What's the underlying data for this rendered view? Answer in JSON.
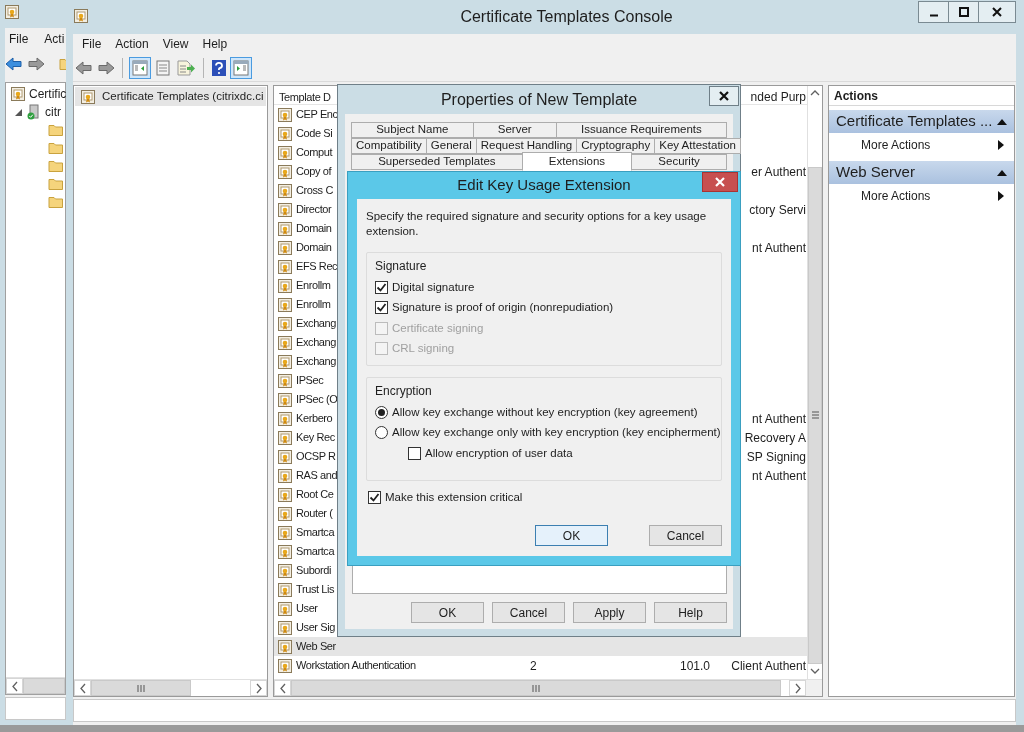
{
  "background_window": {
    "menu": [
      "File",
      "Acti"
    ],
    "tree": [
      {
        "label": "Certific",
        "children": [
          {
            "label": "citr",
            "expanded": true
          }
        ]
      }
    ]
  },
  "main_window": {
    "title": "Certificate Templates Console",
    "menu": [
      "File",
      "Action",
      "View",
      "Help"
    ],
    "tree": [
      {
        "label": "Certificate Templates (citrixdc.ci",
        "selected": true
      }
    ],
    "template_list": {
      "columns": [
        "Template D",
        "nded Purp"
      ],
      "rows": [
        {
          "name": "CEP Enc",
          "selected": false
        },
        {
          "name": "Code Si",
          "selected": false
        },
        {
          "name": "Comput",
          "selected": false
        },
        {
          "name": "Copy of",
          "purpose": "er Authent",
          "selected": false
        },
        {
          "name": "Cross C",
          "selected": false
        },
        {
          "name": "Director",
          "purpose": "ctory Servi",
          "selected": false
        },
        {
          "name": "Domain",
          "selected": false
        },
        {
          "name": "Domain",
          "purpose": "nt Authent",
          "selected": false
        },
        {
          "name": "EFS Rec",
          "selected": false
        },
        {
          "name": "Enrollm",
          "selected": false
        },
        {
          "name": "Enrollm",
          "selected": false
        },
        {
          "name": "Exchang",
          "selected": false
        },
        {
          "name": "Exchang",
          "selected": false
        },
        {
          "name": "Exchang",
          "selected": false
        },
        {
          "name": "IPSec",
          "selected": false
        },
        {
          "name": "IPSec (O",
          "selected": false
        },
        {
          "name": "Kerbero",
          "purpose": "nt Authent",
          "selected": false
        },
        {
          "name": "Key Rec",
          "purpose": "Recovery A",
          "selected": false
        },
        {
          "name": "OCSP R",
          "purpose": "SP Signing",
          "selected": false
        },
        {
          "name": "RAS and",
          "purpose": "nt Authent",
          "selected": false
        },
        {
          "name": "Root Ce",
          "selected": false
        },
        {
          "name": "Router (",
          "selected": false
        },
        {
          "name": "Smartca",
          "selected": false
        },
        {
          "name": "Smartca",
          "selected": false
        },
        {
          "name": "Subordi",
          "selected": false
        },
        {
          "name": "Trust Lis",
          "selected": false
        },
        {
          "name": "User",
          "selected": false
        },
        {
          "name": "User Sig",
          "selected": false
        },
        {
          "name": "Web Ser",
          "selected": true
        },
        {
          "name": "Workstation Authentication",
          "column_2": "2",
          "column_3": "101.0",
          "purpose": "Client Authent",
          "selected": false
        }
      ]
    },
    "actions": {
      "title": "Actions",
      "groups": [
        {
          "title": "Certificate Templates ...",
          "expanded": true,
          "items": [
            "More Actions"
          ]
        },
        {
          "title": "Web Server",
          "expanded": true,
          "items": [
            "More Actions"
          ]
        }
      ]
    }
  },
  "properties_dialog": {
    "title": "Properties of New Template",
    "tab_rows": [
      {
        "tabs": [
          {
            "label": "Subject Name",
            "selected": false
          },
          {
            "label": "Server",
            "selected": false
          },
          {
            "label": "Issuance Requirements",
            "selected": false
          }
        ]
      },
      {
        "tabs": [
          {
            "label": "Compatibility",
            "selected": false
          },
          {
            "label": "General",
            "selected": false
          },
          {
            "label": "Request Handling",
            "selected": false
          },
          {
            "label": "Cryptography",
            "selected": false
          },
          {
            "label": "Key Attestation",
            "selected": false
          }
        ]
      },
      {
        "tabs": [
          {
            "label": "Superseded Templates",
            "selected": false
          },
          {
            "label": "Extensions",
            "selected": true
          },
          {
            "label": "Security",
            "selected": false
          }
        ]
      }
    ],
    "buttons": [
      "OK",
      "Cancel",
      "Apply",
      "Help"
    ]
  },
  "key_usage_dialog": {
    "title": "Edit Key Usage Extension",
    "description": "Specify the required signature and security options for a key usage extension.",
    "signature": {
      "title": "Signature",
      "options": [
        {
          "label": "Digital signature",
          "checked": true,
          "disabled": false
        },
        {
          "label": "Signature is proof of origin (nonrepudiation)",
          "checked": true,
          "disabled": false
        },
        {
          "label": "Certificate signing",
          "checked": false,
          "disabled": true
        },
        {
          "label": "CRL signing",
          "checked": false,
          "disabled": true
        }
      ]
    },
    "encryption": {
      "title": "Encryption",
      "options": [
        {
          "kind": "radio",
          "label": "Allow key exchange without key encryption (key agreement)",
          "selected": true
        },
        {
          "kind": "radio",
          "label": "Allow key exchange only with key encryption (key encipherment)",
          "selected": false
        },
        {
          "kind": "checkbox",
          "label": "Allow encryption of user data",
          "checked": false
        }
      ]
    },
    "critical": {
      "label": "Make this extension critical",
      "checked": true
    },
    "buttons": [
      {
        "label": "OK",
        "default": true
      },
      {
        "label": "Cancel",
        "default": false
      }
    ]
  }
}
